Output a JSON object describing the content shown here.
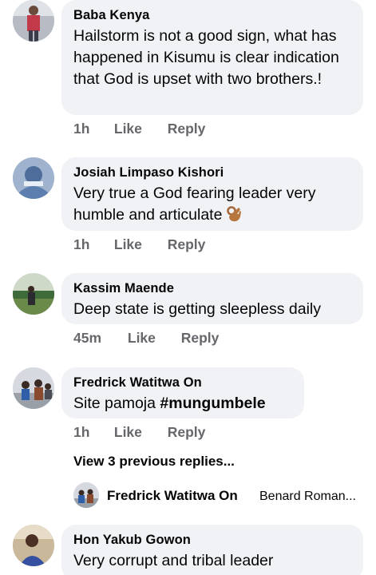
{
  "comments": [
    {
      "author": "Baba Kenya",
      "text": "Hailstorm is not a good sign, what has happened in Kisumu is clear indication that God is upset with two brothers.!",
      "time": "1h",
      "like_label": "Like",
      "reply_label": "Reply",
      "avatar_icon": "person-photo-avatar"
    },
    {
      "author": "Josiah Limpaso Kishori",
      "text": "Very true a God fearing leader very humble and articulate",
      "emoji_icon": "ok-hand-icon",
      "time": "1h",
      "like_label": "Like",
      "reply_label": "Reply",
      "avatar_icon": "illustration-avatar"
    },
    {
      "author": "Kassim Maende",
      "text": "Deep state is getting sleepless daily",
      "time": "45m",
      "like_label": "Like",
      "reply_label": "Reply",
      "avatar_icon": "outdoor-photo-avatar"
    },
    {
      "author": "Fredrick Watitwa On",
      "text_prefix": "Site pamoja ",
      "text_hashtag": "#mungumbele",
      "time": "1h",
      "like_label": "Like",
      "reply_label": "Reply",
      "avatar_icon": "group-photo-avatar"
    },
    {
      "author": "Hon Yakub Gowon",
      "text": "Very corrupt and tribal leader",
      "avatar_icon": "person-photo-avatar"
    }
  ],
  "replies": {
    "view_previous": "View 3 previous replies...",
    "latest_reply_author": "Fredrick Watitwa On",
    "latest_reply_snippet": "Benard Roman..."
  },
  "colors": {
    "bubble_bg": "#f0f2f5",
    "meta_text": "#65676b",
    "primary_text": "#050505"
  }
}
